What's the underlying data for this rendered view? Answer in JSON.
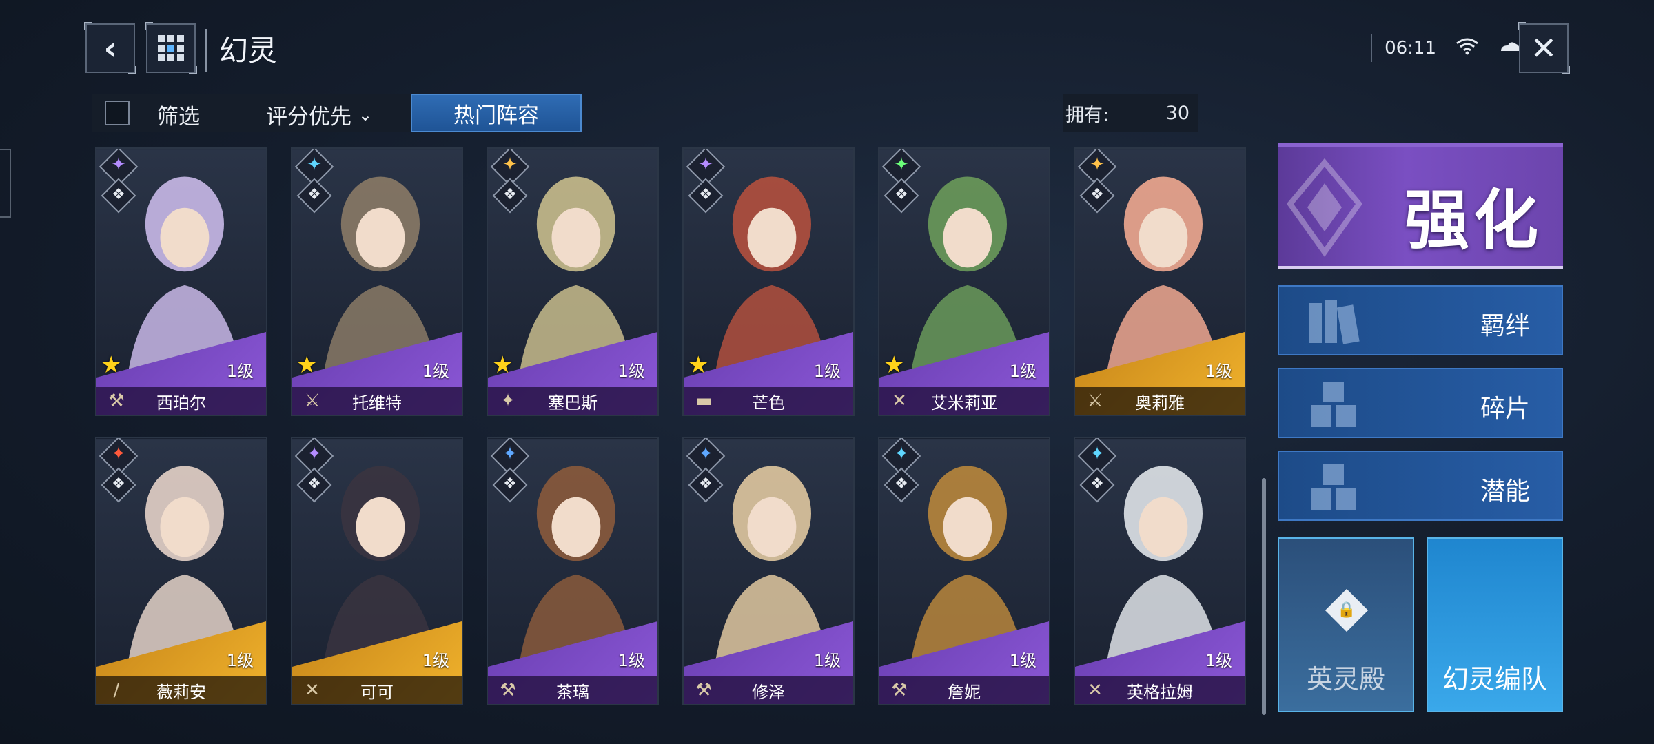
{
  "header": {
    "title": "幻灵"
  },
  "status": {
    "time": "06:11"
  },
  "filter": {
    "filter_label": "筛选",
    "sort_label": "评分优先",
    "hot_label": "热门阵容",
    "owned_label": "拥有:",
    "owned_count": "30"
  },
  "cards": [
    {
      "name": "西珀尔",
      "level": "1级",
      "star": "★",
      "band": "purple",
      "elem_color": "#b48cff",
      "skin": "#c9b9e8",
      "weapon": "⚒"
    },
    {
      "name": "托维特",
      "level": "1级",
      "star": "★",
      "band": "purple",
      "elem_color": "#5fd6ff",
      "skin": "#8a7a66",
      "weapon": "⚔"
    },
    {
      "name": "塞巴斯",
      "level": "1级",
      "star": "★",
      "band": "purple",
      "elem_color": "#ffc24a",
      "skin": "#c8bc8c",
      "weapon": "✦"
    },
    {
      "name": "芒色",
      "level": "1级",
      "star": "★",
      "band": "purple",
      "elem_color": "#b48cff",
      "skin": "#b2503e",
      "weapon": "▬"
    },
    {
      "name": "艾米莉亚",
      "level": "1级",
      "star": "★",
      "band": "purple",
      "elem_color": "#6cff7a",
      "skin": "#6a9a5a",
      "weapon": "✕"
    },
    {
      "name": "奥莉雅",
      "level": "1级",
      "star": "",
      "band": "gold",
      "elem_color": "#ffc24a",
      "skin": "#f0a890",
      "weapon": "⚔"
    },
    {
      "name": "薇莉安",
      "level": "1级",
      "star": "",
      "band": "gold",
      "elem_color": "#ff5a3c",
      "skin": "#e4d2c8",
      "weapon": "/"
    },
    {
      "name": "可可",
      "level": "1级",
      "star": "",
      "band": "gold",
      "elem_color": "#b48cff",
      "skin": "#3a3440",
      "weapon": "✕"
    },
    {
      "name": "茶璃",
      "level": "1级",
      "star": "",
      "band": "purple",
      "elem_color": "#5fa8ff",
      "skin": "#8a5a3c",
      "weapon": "⚒"
    },
    {
      "name": "修泽",
      "level": "1级",
      "star": "",
      "band": "purple",
      "elem_color": "#5fa8ff",
      "skin": "#e0c8a0",
      "weapon": "⚒"
    },
    {
      "name": "詹妮",
      "level": "1级",
      "star": "",
      "band": "purple",
      "elem_color": "#5fd6ff",
      "skin": "#b8863c",
      "weapon": "⚒"
    },
    {
      "name": "英格拉姆",
      "level": "1级",
      "star": "",
      "band": "purple",
      "elem_color": "#5fd6ff",
      "skin": "#dfe3e8",
      "weapon": "✕"
    }
  ],
  "panel": {
    "strengthen": "强化",
    "bond": "羁绊",
    "fragments": "碎片",
    "potential": "潜能",
    "hall": "英灵殿",
    "formation": "幻灵编队"
  }
}
